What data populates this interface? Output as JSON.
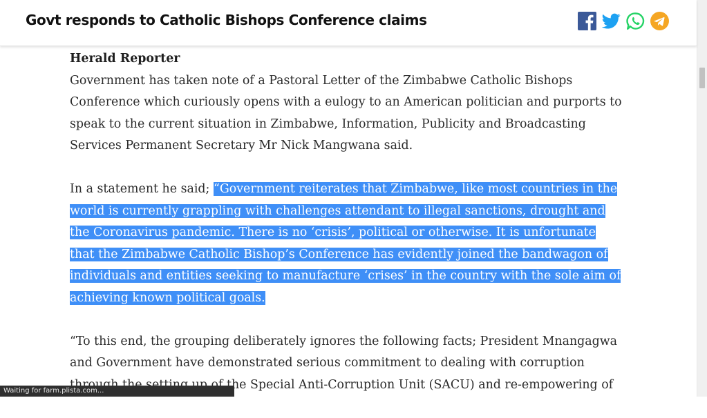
{
  "header": {
    "title": "Govt responds to Catholic Bishops Conference claims",
    "share_icons": [
      "facebook-icon",
      "twitter-icon",
      "whatsapp-icon",
      "telegram-icon"
    ],
    "colors": {
      "facebook": "#3b5998",
      "twitter": "#1da1f2",
      "whatsapp": "#25d366",
      "telegram": "#f5a623"
    }
  },
  "article": {
    "byline": "Herald Reporter",
    "paragraph1": "Government has taken note of a Pastoral Letter of the Zimbabwe Catholic Bishops Conference which curiously opens with a eulogy to an American politician and purports to speak to the current situation in Zimbabwe, Information, Publicity and Broadcasting Services Permanent Secretary Mr Nick Mangwana said.",
    "paragraph2_intro": "In a statement he said; ",
    "paragraph2_quote": "“Government reiterates that Zimbabwe, like most countries in the world is currently grappling with challenges attendant to illegal sanctions, drought and the Coronavirus pandemic. There is no ‘crisis’, political or otherwise. It is unfortunate that the Zimbabwe Catholic Bishop’s Conference has evidently joined the bandwagon of individuals and entities seeking to manufacture ‘crises’ in the country with the sole aim of achieving known political goals.",
    "paragraph3": "“To this end, the grouping deliberately ignores the following facts; President Mnangagwa and Government have demonstrated serious commitment to dealing with corruption through the setting up of the Special Anti-Corruption Unit (SACU) and re-empowering of",
    "highlight_color": "#3f8ff7"
  },
  "status": {
    "text": "Waiting for farm.plista.com..."
  }
}
